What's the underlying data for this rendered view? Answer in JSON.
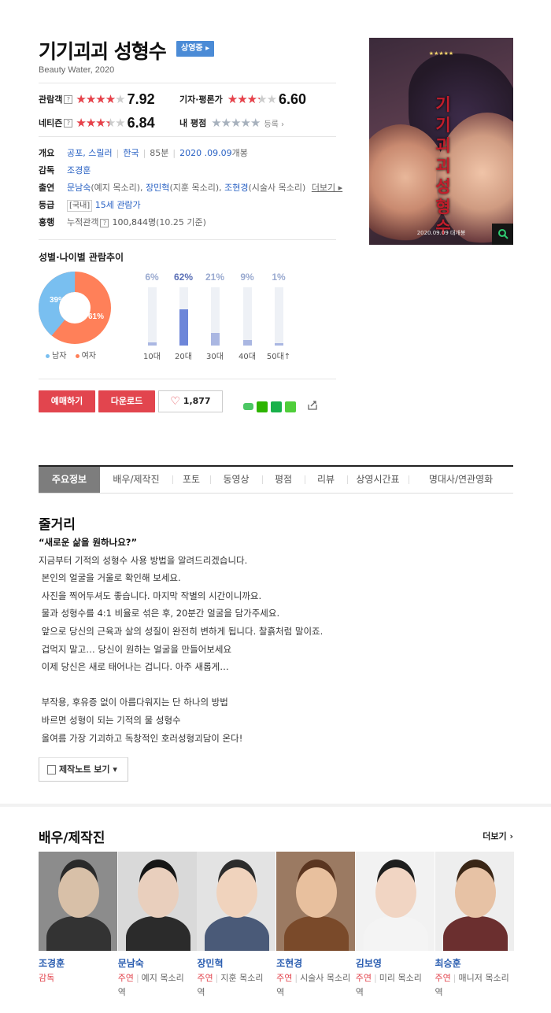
{
  "header": {
    "title": "기기괴괴 성형수",
    "status_badge": "상영중 ▸",
    "subtitle": "Beauty Water, 2020"
  },
  "ratings": {
    "audience": {
      "label": "관람객",
      "score": "7.92",
      "stars": 4
    },
    "critic": {
      "label": "기자·평론가",
      "score": "6.60",
      "stars": 3.3
    },
    "netizen": {
      "label": "네티즌",
      "score": "6.84",
      "stars": 3.4
    },
    "my": {
      "label": "내 평점",
      "stars": 0,
      "register": "등록 ›"
    },
    "help_icon": "?"
  },
  "info": {
    "overview": {
      "label": "개요",
      "genre": "공포, 스릴러",
      "country": "한국",
      "runtime": "85분",
      "release_date": "2020 .09.09",
      "release_suffix": "개봉"
    },
    "director": {
      "label": "감독",
      "name": "조경훈"
    },
    "cast": {
      "label": "출연",
      "a1": "문남숙",
      "r1": "(예지 목소리), ",
      "a2": "장민혁",
      "r2": "(지훈 목소리), ",
      "a3": "조현경",
      "r3": "(시술사 목소리)",
      "more": "더보기 ▸"
    },
    "grade": {
      "label": "등급",
      "region": "[국내]",
      "rating": "15세 관람가"
    },
    "box_office": {
      "label": "흥행",
      "cumulative_label": "누적관객",
      "count": "100,844명",
      "basis": "(10.25 기준)"
    }
  },
  "poster": {
    "top_text": "★★★★★",
    "title_text": "기기괴괴성형수",
    "date_text": "2020.09.09 대개봉"
  },
  "trends": {
    "title": "성별·나이별 관람추이",
    "gender": {
      "male_pct": 39,
      "female_pct": 61,
      "male_text": "39%",
      "female_text": "61%",
      "male_label": "남자",
      "female_label": "여자"
    },
    "ages": [
      {
        "label": "10대",
        "pct": 6,
        "text": "6%"
      },
      {
        "label": "20대",
        "pct": 62,
        "text": "62%"
      },
      {
        "label": "30대",
        "pct": 21,
        "text": "21%"
      },
      {
        "label": "40대",
        "pct": 9,
        "text": "9%"
      },
      {
        "label": "50대↑",
        "pct": 1,
        "text": "1%"
      }
    ]
  },
  "actions": {
    "reserve": "예매하기",
    "download": "다운로드",
    "likes": "1,877"
  },
  "tabs": [
    "주요정보",
    "배우/제작진",
    "포토",
    "동영상",
    "평점",
    "리뷰",
    "상영시간표",
    "명대사/연관영화"
  ],
  "synopsis": {
    "title": "줄거리",
    "headline": "“새로운 삶을 원하나요?”",
    "lines": [
      "지금부터 기적의 성형수 사용 방법을 알려드리겠습니다.",
      " 본인의 얼굴을 거울로 확인해 보세요.",
      " 사진을 찍어두셔도 좋습니다. 마지막 작별의 시간이니까요.",
      " 물과 성형수를 4:1 비율로 섞은 후, 20분간 얼굴을 담가주세요.",
      " 앞으로 당신의 근육과 살의 성질이 완전히 변하게 됩니다. 찰흙처럼 말이죠.",
      " 겁먹지 말고… 당신이 원하는 얼굴을 만들어보세요",
      " 이제 당신은 새로 태어나는 겁니다. 아주 새롭게…",
      "",
      " 부작용, 후유증 없이 아름다워지는 단 하나의 방법",
      " 바르면 성형이 되는 기적의 물 성형수",
      " 올여름 가장 기괴하고 독창적인 호러성형괴담이 온다!"
    ],
    "note_button": "제작노트 보기 ▾"
  },
  "crew": {
    "title": "배우/제작진",
    "more": "더보기 ›",
    "people": [
      {
        "name": "조경훈",
        "role": "감독",
        "char": ""
      },
      {
        "name": "문남숙",
        "role": "주연",
        "char": "예지 목소리 역"
      },
      {
        "name": "장민혁",
        "role": "주연",
        "char": "지훈 목소리 역"
      },
      {
        "name": "조현경",
        "role": "주연",
        "char": "시술사 목소리 역"
      },
      {
        "name": "김보영",
        "role": "주연",
        "char": "미리 목소리 역"
      },
      {
        "name": "최승훈",
        "role": "주연",
        "char": "매니저 목소리 역"
      }
    ]
  },
  "colors": {
    "accent_red": "#e2454e",
    "link_blue": "#2a62c4",
    "male": "#79bff0",
    "female": "#ff8059",
    "bar": "#aab7e2",
    "bar_highlight": "#6d86d9"
  }
}
